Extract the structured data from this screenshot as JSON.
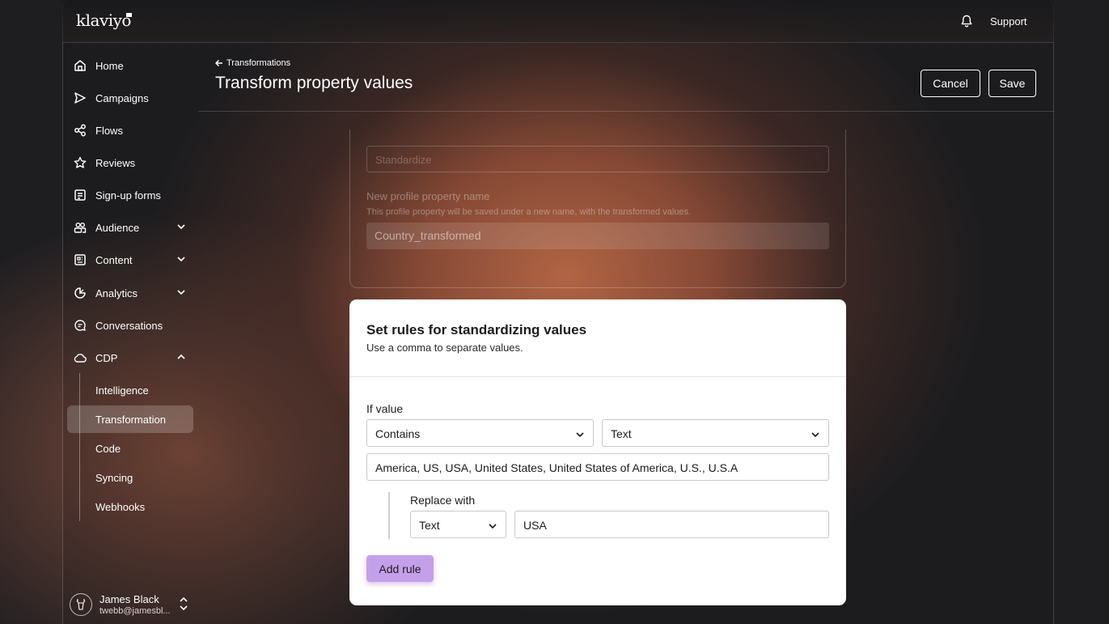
{
  "app": {
    "logo_text": "klaviyo"
  },
  "topbar": {
    "support_label": "Support"
  },
  "sidebar": {
    "items": [
      {
        "label": "Home",
        "icon": "home-icon"
      },
      {
        "label": "Campaigns",
        "icon": "send-icon"
      },
      {
        "label": "Flows",
        "icon": "flows-icon"
      },
      {
        "label": "Reviews",
        "icon": "star-icon"
      },
      {
        "label": "Sign-up forms",
        "icon": "form-icon"
      },
      {
        "label": "Audience",
        "icon": "users-icon"
      },
      {
        "label": "Content",
        "icon": "content-icon"
      },
      {
        "label": "Analytics",
        "icon": "analytics-icon"
      },
      {
        "label": "Conversations",
        "icon": "chat-icon"
      },
      {
        "label": "CDP",
        "icon": "cloud-icon"
      }
    ],
    "cdp_sub_items": [
      "Intelligence",
      "Transformation",
      "Code",
      "Syncing",
      "Webhooks"
    ],
    "active_sub_item": "Transformation"
  },
  "user": {
    "name": "James Black",
    "email": "twebb@jamesbl..."
  },
  "header": {
    "breadcrumb": "Transformations",
    "title": "Transform property values",
    "cancel_label": "Cancel",
    "save_label": "Save"
  },
  "background_form": {
    "method_value": "Standardize",
    "new_property_label": "New profile property name",
    "new_property_help": "This profile property will be saved under a new name, with the transformed values.",
    "new_property_value": "Country_transformed"
  },
  "rules_card": {
    "title": "Set rules for standardizing values",
    "subtitle": "Use a comma to separate values.",
    "if_value_label": "If value",
    "condition_select": "Contains",
    "type_select": "Text",
    "values_input": "America, US, USA, United States, United States of America, U.S., U.S.A",
    "replace_with_label": "Replace with",
    "replace_type_select": "Text",
    "replace_value_input": "USA",
    "add_rule_label": "Add rule"
  },
  "colors": {
    "accent_button": "#c5a0ea",
    "background_glow": "#d67850"
  }
}
